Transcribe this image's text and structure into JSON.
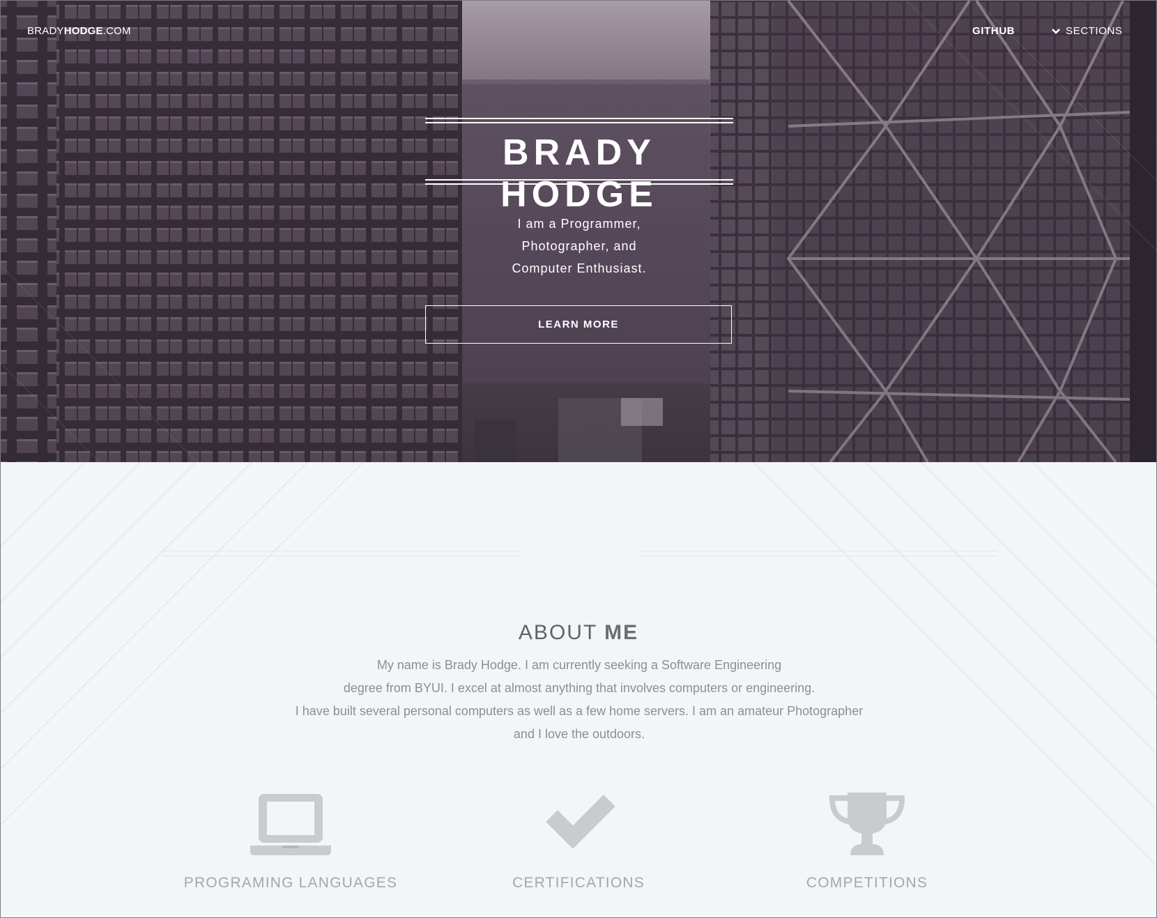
{
  "nav": {
    "brand_prefix": "BRADY",
    "brand_bold": "HODGE",
    "brand_suffix": ".COM",
    "github": "GITHUB",
    "sections": "SECTIONS"
  },
  "hero": {
    "title": "BRADY HODGE",
    "subtitle_lines": [
      "I am a Programmer,",
      "Photographer, and",
      "Computer Enthusiast."
    ],
    "button": "LEARN MORE"
  },
  "about": {
    "title_light": "ABOUT",
    "title_bold": "ME",
    "paragraph_lines": [
      "My name is Brady Hodge. I am currently seeking a Software Engineering",
      "degree from BYUI. I excel at almost anything that involves computers or engineering.",
      "I have built several personal computers as well as a few home servers. I am an amateur Photographer",
      "and I love the outdoors."
    ],
    "features": [
      {
        "icon": "laptop-icon",
        "label": "PROGRAMING LANGUAGES"
      },
      {
        "icon": "checkmark-icon",
        "label": "CERTIFICATIONS"
      },
      {
        "icon": "trophy-icon",
        "label": "COMPETITIONS"
      }
    ]
  },
  "colors": {
    "hero_tint": "#4a3f4c",
    "about_bg": "#f3f6f9",
    "icon_gray": "#c9cbcd"
  }
}
